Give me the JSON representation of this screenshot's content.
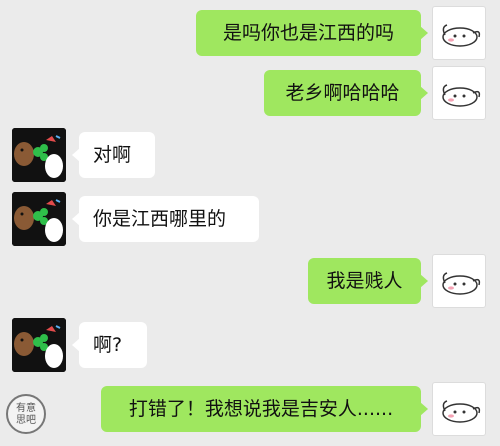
{
  "messages": [
    {
      "side": "out",
      "text": "是吗你也是江西的吗",
      "avatar_icon": "rabbit-icon"
    },
    {
      "side": "out",
      "text": "老乡啊哈哈哈",
      "avatar_icon": "rabbit-icon"
    },
    {
      "side": "in",
      "text": "对啊",
      "avatar_icon": "bear-clover-icon"
    },
    {
      "side": "in",
      "text": "你是江西哪里的",
      "avatar_icon": "bear-clover-icon"
    },
    {
      "side": "out",
      "text": "我是贱人",
      "avatar_icon": "rabbit-icon"
    },
    {
      "side": "in",
      "text": "啊?",
      "avatar_icon": "bear-clover-icon"
    },
    {
      "side": "out",
      "text": "打错了！我想说我是吉安人......",
      "avatar_icon": "rabbit-icon"
    }
  ],
  "watermark": {
    "line1": "有意",
    "line2": "思吧"
  },
  "colors": {
    "background": "#ebebeb",
    "outgoing_bubble": "#9fe75f",
    "incoming_bubble": "#ffffff"
  }
}
